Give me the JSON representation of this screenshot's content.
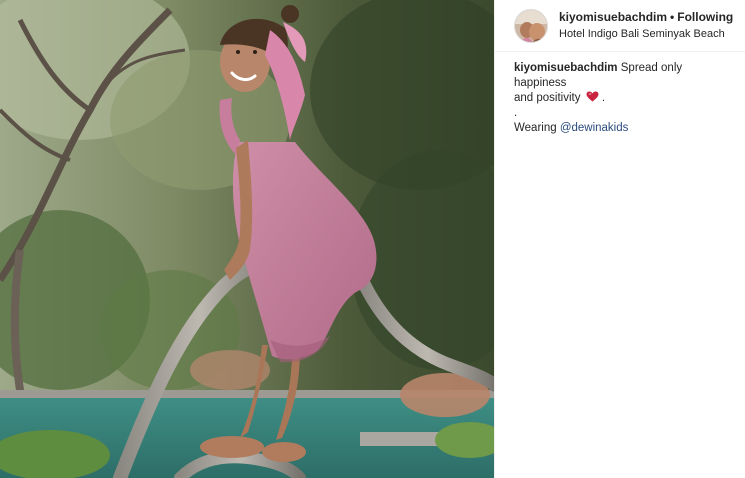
{
  "post": {
    "username": "kiyomisuebachdim",
    "separator": "•",
    "follow_status": "Following",
    "location": "Hotel Indigo Bali Seminyak Beach"
  },
  "caption": {
    "username": "kiyomisuebachdim",
    "line1": "Spread only happiness",
    "line2_text": "and positivity",
    "line2_suffix": " .",
    "line3": ".",
    "wearing_text": "Wearing ",
    "mention": "@dewinakids"
  },
  "icons": {
    "heart": "red-heart-emoji-icon",
    "avatar": "profile-avatar"
  },
  "colors": {
    "text": "#262626",
    "mention": "#2b4c7e",
    "heart": "#c9243f",
    "border": "#efefef"
  }
}
